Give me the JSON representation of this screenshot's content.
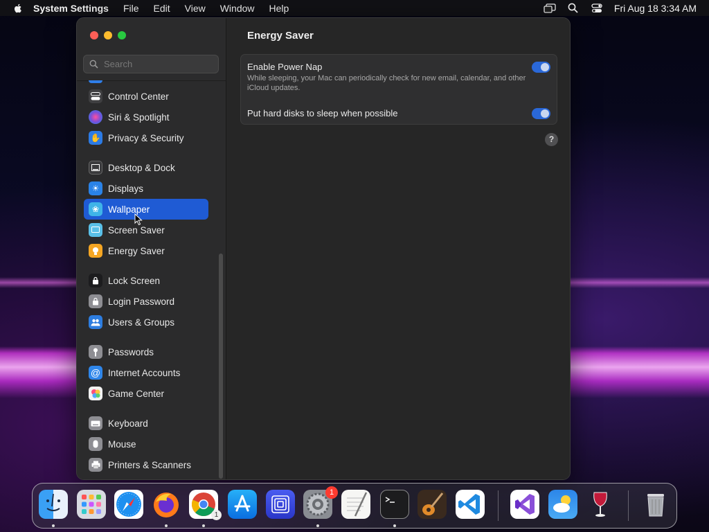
{
  "menubar": {
    "app_name": "System Settings",
    "menus": [
      "File",
      "Edit",
      "View",
      "Window",
      "Help"
    ],
    "datetime": "Fri Aug 18  3:34 AM"
  },
  "sidebar": {
    "search_placeholder": "Search",
    "items": [
      {
        "label": "Control Center",
        "icon": "control-center-icon",
        "color": "#3f3f41"
      },
      {
        "label": "Siri & Spotlight",
        "icon": "siri-icon",
        "color": "#7a4fd9"
      },
      {
        "label": "Privacy & Security",
        "icon": "hand-icon",
        "color": "#2c7be5"
      },
      {
        "label": "Desktop & Dock",
        "icon": "dock-icon",
        "color": "#3a3a3c"
      },
      {
        "label": "Displays",
        "icon": "sun-icon",
        "color": "#2a83e8"
      },
      {
        "label": "Wallpaper",
        "icon": "flower-icon",
        "color": "#3fb4e8"
      },
      {
        "label": "Screen Saver",
        "icon": "screen-saver-icon",
        "color": "#5ac0e8"
      },
      {
        "label": "Energy Saver",
        "icon": "bulb-icon",
        "color": "#f5a623"
      },
      {
        "label": "Lock Screen",
        "icon": "lock-icon",
        "color": "#1c1c1e"
      },
      {
        "label": "Login Password",
        "icon": "login-lock-icon",
        "color": "#8e8e93"
      },
      {
        "label": "Users & Groups",
        "icon": "users-icon",
        "color": "#2d7de0"
      },
      {
        "label": "Passwords",
        "icon": "key-icon",
        "color": "#8e8e93"
      },
      {
        "label": "Internet Accounts",
        "icon": "at-icon",
        "color": "#2f86ea"
      },
      {
        "label": "Game Center",
        "icon": "game-center-icon",
        "color": "#f2f2f2"
      },
      {
        "label": "Keyboard",
        "icon": "keyboard-icon",
        "color": "#8e8e93"
      },
      {
        "label": "Mouse",
        "icon": "mouse-icon",
        "color": "#8e8e93"
      },
      {
        "label": "Printers & Scanners",
        "icon": "printer-icon",
        "color": "#8e8e93"
      }
    ],
    "selected": "Wallpaper"
  },
  "content": {
    "title": "Energy Saver",
    "power_nap": {
      "title": "Enable Power Nap",
      "description": "While sleeping, your Mac can periodically check for new email, calendar, and other iCloud updates.",
      "enabled": true
    },
    "hard_disks": {
      "title": "Put hard disks to sleep when possible",
      "enabled": true
    },
    "help_label": "?"
  },
  "dock": {
    "apps": [
      "finder-icon",
      "launchpad-icon",
      "safari-icon",
      "firefox-icon",
      "chrome-icon",
      "app-store-icon",
      "screen-mirroring-icon",
      "system-settings-icon",
      "textedit-icon",
      "terminal-icon",
      "garageband-icon",
      "vscode-icon",
      "visual-studio-icon",
      "weather-icon",
      "wine-icon",
      "trash-icon"
    ],
    "settings_badge": "1",
    "chrome_badge": "1"
  }
}
